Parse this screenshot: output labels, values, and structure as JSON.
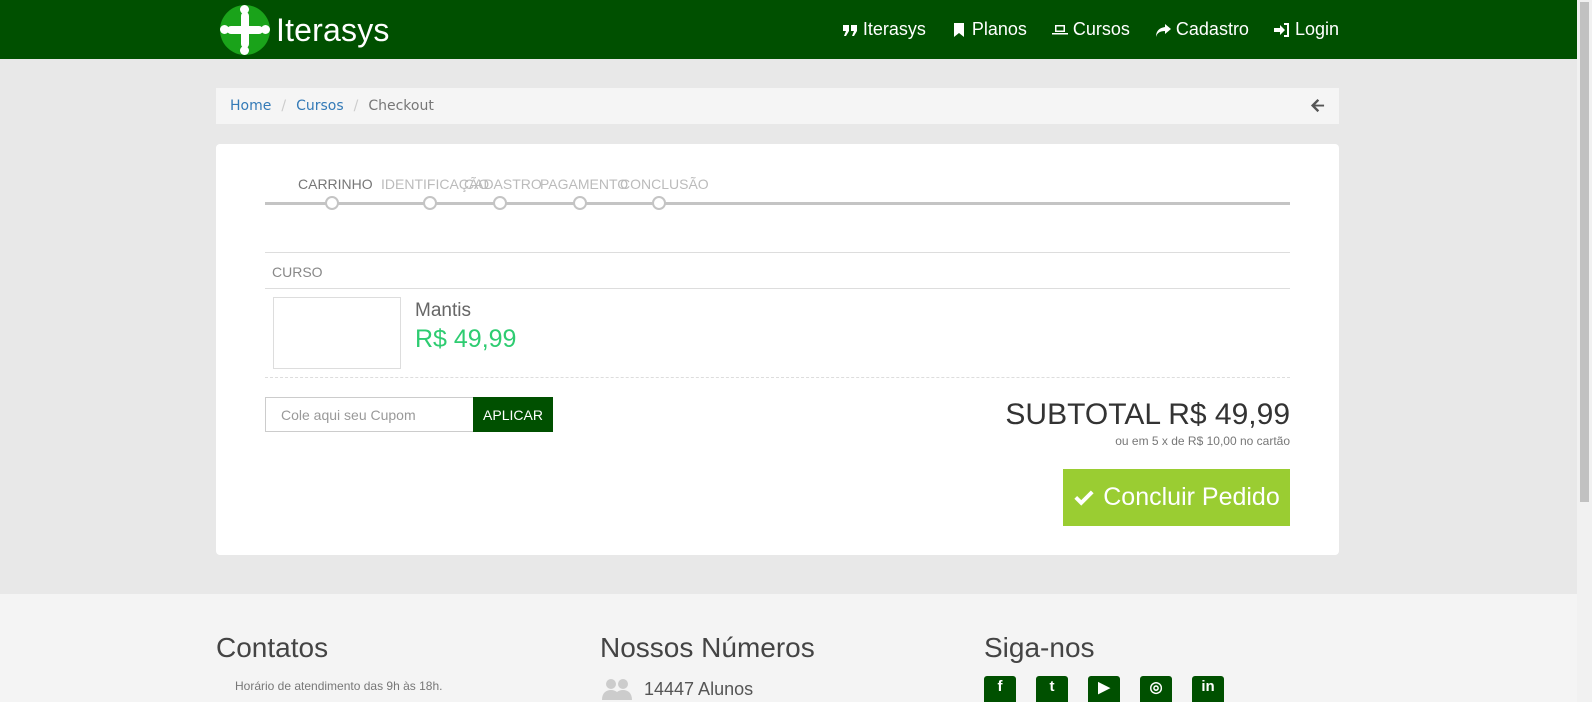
{
  "navbar": {
    "brand": "Iterasys",
    "links": [
      {
        "label": "Iterasys",
        "icon": "quote-icon"
      },
      {
        "label": "Planos",
        "icon": "bookmark-icon"
      },
      {
        "label": "Cursos",
        "icon": "laptop-icon"
      },
      {
        "label": "Cadastro",
        "icon": "share-icon"
      },
      {
        "label": "Login",
        "icon": "sign-in-icon"
      }
    ]
  },
  "breadcrumb": {
    "items": [
      "Home",
      "Cursos"
    ],
    "current": "Checkout"
  },
  "steps": [
    "CARRINHO",
    "IDENTIFICAÇÃO",
    "CADASTRO",
    "PAGAMENTO",
    "CONCLUSÃO"
  ],
  "cart": {
    "column_header": "CURSO",
    "items": [
      {
        "name": "Mantis",
        "price": "R$ 49,99"
      }
    ]
  },
  "coupon": {
    "placeholder": "Cole aqui seu Cupom",
    "apply_label": "APLICAR"
  },
  "summary": {
    "subtotal": "SUBTOTAL R$ 49,99",
    "installments": "ou em 5 x de R$ 10,00 no cartão",
    "conclude_label": "Concluir Pedido"
  },
  "footer": {
    "contacts_title": "Contatos",
    "contacts_hours": "Horário de atendimento das 9h às 18h.",
    "numbers_title": "Nossos Números",
    "students": "14447 Alunos",
    "social_title": "Siga-nos",
    "social_icons": [
      "facebook-icon",
      "twitter-icon",
      "youtube-icon",
      "instagram-icon",
      "linkedin-icon"
    ]
  },
  "colors": {
    "brand_green": "#005000",
    "price_green": "#2ecc71",
    "cta_green": "#9acd32",
    "link_blue": "#337ab7"
  }
}
